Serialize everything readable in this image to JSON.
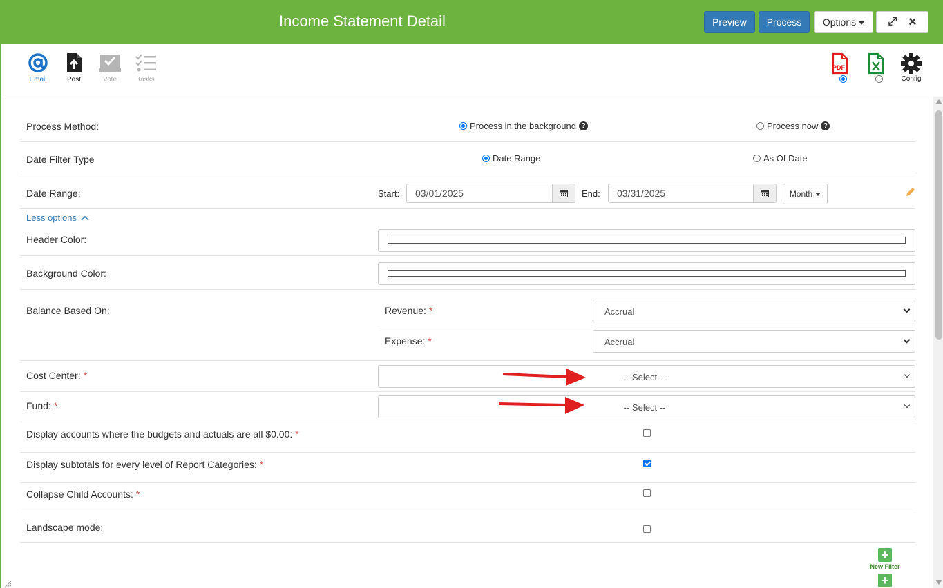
{
  "header": {
    "title": "Income Statement Detail",
    "preview_label": "Preview",
    "process_label": "Process",
    "options_label": "Options",
    "close_glyph": "×",
    "expand_glyph": "⤢",
    "color": "#6db33f"
  },
  "toolbar": {
    "email_label": "Email",
    "post_label": "Post",
    "vote_label": "Vote",
    "tasks_label": "Tasks",
    "pdf_text": "PDF",
    "config_label": "Config",
    "export_format": "pdf"
  },
  "form": {
    "process_method": {
      "label": "Process Method:",
      "option_background": "Process in the background",
      "option_now": "Process now",
      "selected": "background"
    },
    "date_filter_type": {
      "label": "Date Filter Type",
      "option_range": "Date Range",
      "option_asof": "As Of Date",
      "selected": "range"
    },
    "date_range": {
      "label": "Date Range:",
      "start_label": "Start:",
      "start_value": "03/01/2025",
      "end_label": "End:",
      "end_value": "03/31/2025",
      "period_label": "Month"
    },
    "less_options_label": "Less options",
    "header_color_label": "Header Color:",
    "background_color_label": "Background Color:",
    "balance_based_on": {
      "label": "Balance Based On:",
      "revenue_label": "Revenue:",
      "revenue_value": "Accrual",
      "expense_label": "Expense:",
      "expense_value": "Accrual"
    },
    "cost_center": {
      "label": "Cost Center:",
      "value": "-- Select --"
    },
    "fund": {
      "label": "Fund:",
      "value": "-- Select --"
    },
    "display_zero_accounts": {
      "label": "Display accounts where the budgets and actuals are all $0.00:",
      "checked": false
    },
    "display_subtotals": {
      "label": "Display subtotals for every level of Report Categories:",
      "checked": true
    },
    "collapse_child": {
      "label": "Collapse Child Accounts:",
      "checked": false
    },
    "landscape_mode": {
      "label": "Landscape mode:",
      "checked": false
    },
    "required_mark": "*",
    "new_filter_label": "New Filter"
  }
}
